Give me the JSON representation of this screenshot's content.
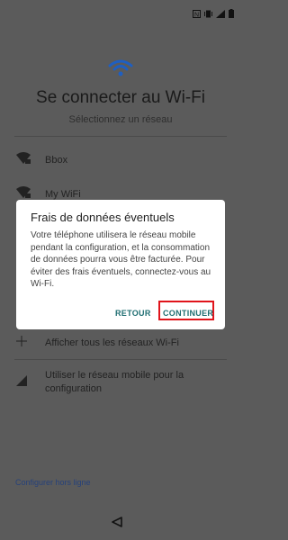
{
  "title": "Se connecter au Wi-Fi",
  "subtitle": "Sélectionnez un réseau",
  "networks": [
    {
      "name": "Bbox"
    },
    {
      "name": "My WiFi"
    }
  ],
  "bottom_options": [
    {
      "label": "Afficher tous les réseaux Wi-Fi"
    },
    {
      "label": "Utiliser le réseau mobile pour la configuration"
    }
  ],
  "offline_link": "Configurer hors ligne",
  "dialog": {
    "title": "Frais de données éventuels",
    "body": "Votre téléphone utilisera le réseau mobile pendant la configuration, et la consommation de données pourra vous être facturée. Pour éviter des frais éventuels, connectez-vous au Wi-Fi.",
    "retour_label": "RETOUR",
    "continuer_label": "CONTINUER"
  },
  "colors": {
    "accent": "#1f6e72",
    "wifi_logo": "#1e5fc2",
    "highlight": "#e0141b"
  }
}
